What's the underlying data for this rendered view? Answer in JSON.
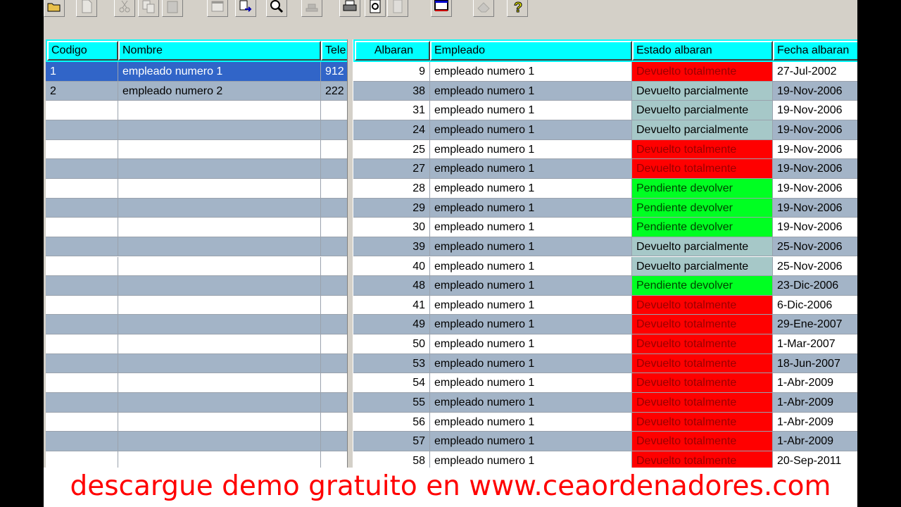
{
  "toolbar": {
    "buttons": [
      "open-icon",
      "new-document-icon",
      "cut-icon",
      "copy-icon",
      "paste-icon",
      "window-icon",
      "export-icon",
      "find-icon",
      "stamp-icon",
      "print-icon",
      "print-preview-icon",
      "page-icon",
      "monitor-icon",
      "eraser-icon",
      "help-icon"
    ]
  },
  "employees": {
    "columns": [
      "Codigo",
      "Nombre",
      "Tele"
    ],
    "rows": [
      {
        "codigo": "1",
        "nombre": "empleado numero 1",
        "tel": "912",
        "selected": true
      },
      {
        "codigo": "2",
        "nombre": "empleado numero 2",
        "tel": "222",
        "selected": false
      }
    ],
    "empty_rows": 19
  },
  "delivery_notes": {
    "columns": [
      "Albaran",
      "Empleado",
      "Estado albaran",
      "Fecha albaran"
    ],
    "rows": [
      {
        "albaran": "9",
        "empleado": "empleado numero 1",
        "estado": "Devuelto totalmente",
        "fecha": "27-Jul-2002"
      },
      {
        "albaran": "38",
        "empleado": "empleado numero 1",
        "estado": "Devuelto parcialmente",
        "fecha": "19-Nov-2006"
      },
      {
        "albaran": "31",
        "empleado": "empleado numero 1",
        "estado": "Devuelto parcialmente",
        "fecha": "19-Nov-2006"
      },
      {
        "albaran": "24",
        "empleado": "empleado numero 1",
        "estado": "Devuelto parcialmente",
        "fecha": "19-Nov-2006"
      },
      {
        "albaran": "25",
        "empleado": "empleado numero 1",
        "estado": "Devuelto totalmente",
        "fecha": "19-Nov-2006"
      },
      {
        "albaran": "27",
        "empleado": "empleado numero 1",
        "estado": "Devuelto totalmente",
        "fecha": "19-Nov-2006"
      },
      {
        "albaran": "28",
        "empleado": "empleado numero 1",
        "estado": "Pendiente devolver",
        "fecha": "19-Nov-2006"
      },
      {
        "albaran": "29",
        "empleado": "empleado numero 1",
        "estado": "Pendiente devolver",
        "fecha": "19-Nov-2006"
      },
      {
        "albaran": "30",
        "empleado": "empleado numero 1",
        "estado": "Pendiente devolver",
        "fecha": "19-Nov-2006"
      },
      {
        "albaran": "39",
        "empleado": "empleado numero 1",
        "estado": "Devuelto parcialmente",
        "fecha": "25-Nov-2006"
      },
      {
        "albaran": "40",
        "empleado": "empleado numero 1",
        "estado": "Devuelto parcialmente",
        "fecha": "25-Nov-2006"
      },
      {
        "albaran": "48",
        "empleado": "empleado numero 1",
        "estado": "Pendiente devolver",
        "fecha": "23-Dic-2006"
      },
      {
        "albaran": "41",
        "empleado": "empleado numero 1",
        "estado": "Devuelto totalmente",
        "fecha": "6-Dic-2006"
      },
      {
        "albaran": "49",
        "empleado": "empleado numero 1",
        "estado": "Devuelto totalmente",
        "fecha": "29-Ene-2007"
      },
      {
        "albaran": "50",
        "empleado": "empleado numero 1",
        "estado": "Devuelto totalmente",
        "fecha": "1-Mar-2007"
      },
      {
        "albaran": "53",
        "empleado": "empleado numero 1",
        "estado": "Devuelto totalmente",
        "fecha": "18-Jun-2007"
      },
      {
        "albaran": "54",
        "empleado": "empleado numero 1",
        "estado": "Devuelto totalmente",
        "fecha": "1-Abr-2009"
      },
      {
        "albaran": "55",
        "empleado": "empleado numero 1",
        "estado": "Devuelto totalmente",
        "fecha": "1-Abr-2009"
      },
      {
        "albaran": "56",
        "empleado": "empleado numero 1",
        "estado": "Devuelto totalmente",
        "fecha": "1-Abr-2009"
      },
      {
        "albaran": "57",
        "empleado": "empleado numero 1",
        "estado": "Devuelto totalmente",
        "fecha": "1-Abr-2009"
      },
      {
        "albaran": "58",
        "empleado": "empleado numero 1",
        "estado": "Devuelto totalmente",
        "fecha": "20-Sep-2011"
      }
    ]
  },
  "status_colors": {
    "Devuelto totalmente": "#ff0000",
    "Devuelto parcialmente": "#a6c8c8",
    "Pendiente devolver": "#00ff22"
  },
  "promo": {
    "text": "descargue demo gratuito en www.ceaordenadores.com",
    "color": "#ff0000"
  }
}
